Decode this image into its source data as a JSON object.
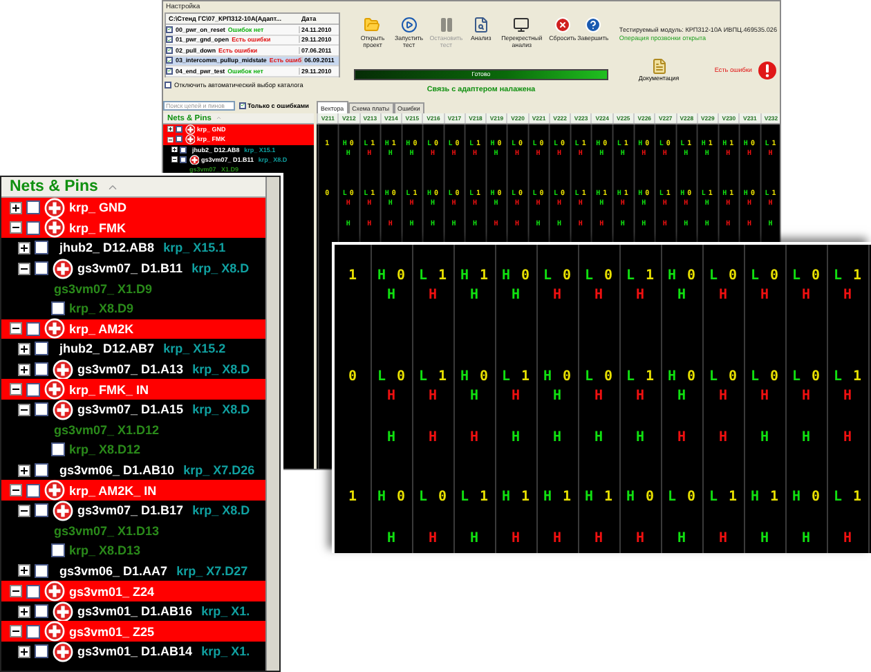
{
  "window": {
    "title": "Настройка"
  },
  "files": {
    "header": "C:\\Стенд ГС\\07_КРП312-10А(Адапт...",
    "date_header": "Дата",
    "items": [
      {
        "name": "00_pwr_on_reset",
        "status": "Ошибок нет",
        "ok": true,
        "date": "24.11.2010",
        "checked": true,
        "selected": false
      },
      {
        "name": "01_pwr_gnd_open",
        "status": "Есть ошибки",
        "ok": false,
        "date": "29.11.2010",
        "checked": true,
        "selected": false
      },
      {
        "name": "02_pull_down",
        "status": "Есть ошибки",
        "ok": false,
        "date": "07.06.2011",
        "checked": true,
        "selected": false
      },
      {
        "name": "03_intercomm_pullup_midstate",
        "status": "Есть ошиб",
        "ok": false,
        "date": "06.09.2011",
        "checked": true,
        "selected": true
      },
      {
        "name": "04_end_pwr_test",
        "status": "Ошибок нет",
        "ok": true,
        "date": "29.11.2010",
        "checked": true,
        "selected": false
      }
    ]
  },
  "auto_select": {
    "label": "Отключить автоматический выбор каталога",
    "checked": false
  },
  "toolbar": [
    {
      "kind": "open",
      "label": "Открыть проект",
      "disabled": false
    },
    {
      "kind": "run",
      "label": "Запустить тест",
      "disabled": false
    },
    {
      "kind": "stop",
      "label": "Остановить тест",
      "disabled": true
    },
    {
      "kind": "analysis",
      "label": "Анализ",
      "disabled": false
    },
    {
      "kind": "cross",
      "label": "Перекрестный анализ",
      "disabled": false
    },
    {
      "kind": "reset",
      "label": "Сбросить",
      "disabled": false
    },
    {
      "kind": "finish",
      "label": "Завершить",
      "disabled": false
    }
  ],
  "progress": {
    "label": "Готово",
    "level": 1
  },
  "connection": "Связь с адаптером налажена",
  "module": {
    "label": "Тестируемый модуль: КРП312-10А ИВПЦ.469535.026",
    "status": "Операция прозвонки открыта"
  },
  "documentation": "Документация",
  "error_status": "Есть ошибки",
  "search": {
    "placeholder": "Поиск цепей и пинов"
  },
  "only_errors": {
    "label": "Только с ошибками",
    "checked": true
  },
  "tree": {
    "header": "Nets & Pins",
    "nets": [
      {
        "kind": "net",
        "name": "krp_ GND",
        "error": true,
        "expanded": false,
        "checked": false
      },
      {
        "kind": "net",
        "name": "krp_ FMK",
        "error": true,
        "expanded": true,
        "checked": false,
        "children": [
          {
            "kind": "pin",
            "name": "jhub2_ D12.AB8",
            "ref": "krp_ X15.1",
            "error": false,
            "expanded": false,
            "checked": false
          },
          {
            "kind": "pin",
            "name": "gs3vm07_ D1.B11",
            "ref": "krp_ X8.D",
            "error": true,
            "expanded": true,
            "checked": false,
            "children": [
              {
                "kind": "connector",
                "name": "gs3vm07_ X1.D9"
              }
            ]
          }
        ]
      }
    ]
  },
  "tabs": [
    {
      "label": "Вектора",
      "selected": true
    },
    {
      "label": "Схема платы",
      "selected": false
    },
    {
      "label": "Ошибки",
      "selected": false
    }
  ],
  "vectors": {
    "columns": [
      "V211",
      "V212",
      "V213",
      "V214",
      "V215",
      "V216",
      "V217",
      "V218",
      "V219",
      "V220",
      "V221",
      "V222",
      "V223",
      "V224",
      "V225",
      "V226",
      "V227",
      "V228",
      "V229",
      "V230",
      "V231",
      "V232"
    ],
    "rows": [
      {
        "kind": "vector",
        "cells": [
          {
            "text": "1"
          },
          {
            "state": "H",
            "bit": "0"
          },
          {
            "state": "L",
            "bit": "1"
          },
          {
            "state": "H",
            "bit": "1"
          },
          {
            "state": "H",
            "bit": "0"
          },
          {
            "state": "L",
            "bit": "0"
          },
          {
            "state": "L",
            "bit": "0"
          },
          {
            "state": "L",
            "bit": "1"
          },
          {
            "state": "H",
            "bit": "0"
          },
          {
            "state": "L",
            "bit": "0"
          },
          {
            "state": "L",
            "bit": "0"
          },
          {
            "state": "L",
            "bit": "0"
          },
          {
            "state": "L",
            "bit": "1"
          },
          {
            "state": "H",
            "bit": "0"
          },
          {
            "state": "L",
            "bit": "1"
          },
          {
            "state": "H",
            "bit": "0"
          },
          {
            "state": "L",
            "bit": "0"
          },
          {
            "state": "L",
            "bit": "1"
          },
          {
            "state": "H",
            "bit": "1"
          },
          {
            "state": "H",
            "bit": "1"
          },
          {
            "state": "H",
            "bit": "0"
          },
          {
            "state": "L",
            "bit": "1"
          }
        ]
      },
      {
        "kind": "result",
        "cells": [
          {
            "kind": "blank"
          },
          {
            "text": "H",
            "pass": true
          },
          {
            "text": "H",
            "pass": false
          },
          {
            "text": "H",
            "pass": true
          },
          {
            "text": "H",
            "pass": true
          },
          {
            "text": "H",
            "pass": false
          },
          {
            "text": "H",
            "pass": false
          },
          {
            "text": "H",
            "pass": false
          },
          {
            "text": "H",
            "pass": true
          },
          {
            "text": "H",
            "pass": false
          },
          {
            "text": "H",
            "pass": false
          },
          {
            "text": "H",
            "pass": false
          },
          {
            "text": "H",
            "pass": false
          },
          {
            "text": "H",
            "pass": true
          },
          {
            "text": "H",
            "pass": true
          },
          {
            "text": "H",
            "pass": false
          },
          {
            "text": "H",
            "pass": false
          },
          {
            "text": "H",
            "pass": true
          },
          {
            "text": "H",
            "pass": true
          },
          {
            "text": "H",
            "pass": false
          },
          {
            "text": "H",
            "pass": false
          },
          {
            "text": "H",
            "pass": false
          }
        ]
      },
      {
        "kind": "blank"
      },
      {
        "kind": "blank"
      },
      {
        "kind": "blank"
      },
      {
        "kind": "vector",
        "cells": [
          {
            "text": "0"
          },
          {
            "state": "L",
            "bit": "0"
          },
          {
            "state": "L",
            "bit": "1"
          },
          {
            "state": "H",
            "bit": "0"
          },
          {
            "state": "L",
            "bit": "1"
          },
          {
            "state": "H",
            "bit": "0"
          },
          {
            "state": "L",
            "bit": "0"
          },
          {
            "state": "L",
            "bit": "1"
          },
          {
            "state": "H",
            "bit": "0"
          },
          {
            "state": "L",
            "bit": "0"
          },
          {
            "state": "L",
            "bit": "0"
          },
          {
            "state": "L",
            "bit": "0"
          },
          {
            "state": "L",
            "bit": "1"
          },
          {
            "state": "H",
            "bit": "1"
          },
          {
            "state": "H",
            "bit": "1"
          },
          {
            "state": "H",
            "bit": "0"
          },
          {
            "state": "L",
            "bit": "1"
          },
          {
            "state": "H",
            "bit": "0"
          },
          {
            "state": "L",
            "bit": "1"
          },
          {
            "state": "H",
            "bit": "1"
          },
          {
            "state": "H",
            "bit": "0"
          },
          {
            "state": "L",
            "bit": "1"
          }
        ]
      },
      {
        "kind": "result",
        "cells": [
          {
            "kind": "blank"
          },
          {
            "text": "H",
            "pass": false
          },
          {
            "text": "H",
            "pass": false
          },
          {
            "text": "H",
            "pass": true
          },
          {
            "text": "H",
            "pass": false
          },
          {
            "text": "H",
            "pass": true
          },
          {
            "text": "H",
            "pass": false
          },
          {
            "text": "H",
            "pass": false
          },
          {
            "text": "H",
            "pass": true
          },
          {
            "text": "H",
            "pass": false
          },
          {
            "text": "H",
            "pass": false
          },
          {
            "text": "H",
            "pass": false
          },
          {
            "text": "H",
            "pass": false
          },
          {
            "text": "H",
            "pass": true
          },
          {
            "text": "H",
            "pass": false
          },
          {
            "text": "H",
            "pass": true
          },
          {
            "text": "H",
            "pass": false
          },
          {
            "text": "H",
            "pass": false
          },
          {
            "text": "H",
            "pass": true
          },
          {
            "text": "H",
            "pass": false
          },
          {
            "text": "H",
            "pass": false
          },
          {
            "text": "H",
            "pass": false
          }
        ]
      },
      {
        "kind": "blank"
      },
      {
        "kind": "result",
        "cells": [
          {
            "kind": "blank"
          },
          {
            "text": "H",
            "pass": true
          },
          {
            "text": "H",
            "pass": false
          },
          {
            "text": "H",
            "pass": false
          },
          {
            "text": "H",
            "pass": true
          },
          {
            "text": "H",
            "pass": true
          },
          {
            "text": "H",
            "pass": true
          },
          {
            "text": "H",
            "pass": true
          },
          {
            "text": "H",
            "pass": false
          },
          {
            "text": "H",
            "pass": false
          },
          {
            "text": "H",
            "pass": true
          },
          {
            "text": "H",
            "pass": true
          },
          {
            "text": "H",
            "pass": false
          },
          {
            "text": "H",
            "pass": false
          },
          {
            "text": "H",
            "pass": true
          },
          {
            "text": "H",
            "pass": true
          },
          {
            "text": "H",
            "pass": false
          },
          {
            "text": "H",
            "pass": true
          },
          {
            "text": "H",
            "pass": true
          },
          {
            "text": "H",
            "pass": false
          },
          {
            "text": "H",
            "pass": false
          },
          {
            "text": "H",
            "pass": true
          }
        ]
      }
    ]
  },
  "zoom_tree": {
    "header": "Nets & Pins",
    "nets": [
      {
        "kind": "net",
        "name": "krp_ GND",
        "error": true,
        "expanded": false,
        "checked": false
      },
      {
        "kind": "net",
        "name": "krp_ FMK",
        "error": true,
        "expanded": true,
        "checked": false,
        "children": [
          {
            "kind": "pin",
            "name": "jhub2_ D12.AB8",
            "ref": "krp_ X15.1",
            "error": false,
            "expanded": false,
            "checked": false
          },
          {
            "kind": "pin",
            "name": "gs3vm07_ D1.B11",
            "ref": "krp_ X8.D",
            "error": true,
            "expanded": true,
            "checked": false,
            "children": [
              {
                "kind": "connector",
                "name": "gs3vm07_ X1.D9",
                "children": [
                  {
                    "kind": "contact",
                    "name": "krp_ X8.D9",
                    "checked": false
                  }
                ]
              }
            ]
          }
        ]
      },
      {
        "kind": "net",
        "name": "krp_ AM2K",
        "error": true,
        "expanded": true,
        "checked": false,
        "children": [
          {
            "kind": "pin",
            "name": "jhub2_ D12.AB7",
            "ref": "krp_ X15.2",
            "error": false,
            "expanded": false,
            "checked": false
          },
          {
            "kind": "pin",
            "name": "gs3vm07_ D1.A13",
            "ref": "krp_ X8.D",
            "error": true,
            "expanded": false,
            "checked": false
          }
        ]
      },
      {
        "kind": "net",
        "name": "krp_ FMK_ IN",
        "error": true,
        "expanded": true,
        "checked": false,
        "children": [
          {
            "kind": "pin",
            "name": "gs3vm07_ D1.A15",
            "ref": "krp_ X8.D",
            "error": true,
            "expanded": true,
            "checked": false,
            "children": [
              {
                "kind": "connector",
                "name": "gs3vm07_ X1.D12",
                "children": [
                  {
                    "kind": "contact",
                    "name": "krp_ X8.D12",
                    "checked": false
                  }
                ]
              }
            ]
          },
          {
            "kind": "pin",
            "name": "gs3vm06_ D1.AB10",
            "ref": "krp_ X7.D26",
            "error": false,
            "expanded": false,
            "checked": false
          }
        ]
      },
      {
        "kind": "net",
        "name": "krp_ AM2K_ IN",
        "error": true,
        "expanded": true,
        "checked": false,
        "children": [
          {
            "kind": "pin",
            "name": "gs3vm07_ D1.B17",
            "ref": "krp_ X8.D",
            "error": true,
            "expanded": true,
            "checked": false,
            "children": [
              {
                "kind": "connector",
                "name": "gs3vm07_ X1.D13",
                "children": [
                  {
                    "kind": "contact",
                    "name": "krp_ X8.D13",
                    "checked": false
                  }
                ]
              }
            ]
          },
          {
            "kind": "pin",
            "name": "gs3vm06_ D1.AA7",
            "ref": "krp_ X7.D27",
            "error": false,
            "expanded": false,
            "checked": false
          }
        ]
      },
      {
        "kind": "net",
        "name": "gs3vm01_ Z24",
        "error": true,
        "expanded": true,
        "checked": false,
        "children": [
          {
            "kind": "pin",
            "name": "gs3vm01_ D1.AB16",
            "ref": "krp_ X1.",
            "error": true,
            "expanded": false,
            "checked": false
          }
        ]
      },
      {
        "kind": "net",
        "name": "gs3vm01_ Z25",
        "error": true,
        "expanded": true,
        "checked": false,
        "children": [
          {
            "kind": "pin",
            "name": "gs3vm01_ D1.AB14",
            "ref": "krp_ X1.",
            "error": true,
            "expanded": false,
            "checked": false
          }
        ]
      }
    ]
  },
  "zoom_vectors": {
    "rows": [
      {
        "kind": "vector",
        "cells": [
          {
            "text": "1"
          },
          {
            "state": "H",
            "bit": "0"
          },
          {
            "state": "L",
            "bit": "1"
          },
          {
            "state": "H",
            "bit": "1"
          },
          {
            "state": "H",
            "bit": "0"
          },
          {
            "state": "L",
            "bit": "0"
          },
          {
            "state": "L",
            "bit": "0"
          },
          {
            "state": "L",
            "bit": "1"
          },
          {
            "state": "H",
            "bit": "0"
          },
          {
            "state": "L",
            "bit": "0"
          },
          {
            "state": "L",
            "bit": "0"
          },
          {
            "state": "L",
            "bit": "0"
          },
          {
            "state": "L",
            "bit": "1"
          }
        ]
      },
      {
        "kind": "result",
        "cells": [
          {
            "kind": "blank"
          },
          {
            "text": "H",
            "pass": true
          },
          {
            "text": "H",
            "pass": false
          },
          {
            "text": "H",
            "pass": true
          },
          {
            "text": "H",
            "pass": true
          },
          {
            "text": "H",
            "pass": false
          },
          {
            "text": "H",
            "pass": false
          },
          {
            "text": "H",
            "pass": false
          },
          {
            "text": "H",
            "pass": true
          },
          {
            "text": "H",
            "pass": false
          },
          {
            "text": "H",
            "pass": false
          },
          {
            "text": "H",
            "pass": false
          },
          {
            "text": "H",
            "pass": false
          }
        ]
      },
      {
        "kind": "blank"
      },
      {
        "kind": "blank"
      },
      {
        "kind": "blank"
      },
      {
        "kind": "vector",
        "cells": [
          {
            "text": "0"
          },
          {
            "state": "L",
            "bit": "0"
          },
          {
            "state": "L",
            "bit": "1"
          },
          {
            "state": "H",
            "bit": "0"
          },
          {
            "state": "L",
            "bit": "1"
          },
          {
            "state": "H",
            "bit": "0"
          },
          {
            "state": "L",
            "bit": "0"
          },
          {
            "state": "L",
            "bit": "1"
          },
          {
            "state": "H",
            "bit": "0"
          },
          {
            "state": "L",
            "bit": "0"
          },
          {
            "state": "L",
            "bit": "0"
          },
          {
            "state": "L",
            "bit": "0"
          },
          {
            "state": "L",
            "bit": "1"
          }
        ]
      },
      {
        "kind": "result",
        "cells": [
          {
            "kind": "blank"
          },
          {
            "text": "H",
            "pass": false
          },
          {
            "text": "H",
            "pass": false
          },
          {
            "text": "H",
            "pass": true
          },
          {
            "text": "H",
            "pass": false
          },
          {
            "text": "H",
            "pass": true
          },
          {
            "text": "H",
            "pass": false
          },
          {
            "text": "H",
            "pass": false
          },
          {
            "text": "H",
            "pass": true
          },
          {
            "text": "H",
            "pass": false
          },
          {
            "text": "H",
            "pass": false
          },
          {
            "text": "H",
            "pass": false
          },
          {
            "text": "H",
            "pass": false
          }
        ]
      },
      {
        "kind": "blank"
      },
      {
        "kind": "result",
        "cells": [
          {
            "kind": "blank"
          },
          {
            "text": "H",
            "pass": true
          },
          {
            "text": "H",
            "pass": false
          },
          {
            "text": "H",
            "pass": false
          },
          {
            "text": "H",
            "pass": true
          },
          {
            "text": "H",
            "pass": true
          },
          {
            "text": "H",
            "pass": true
          },
          {
            "text": "H",
            "pass": true
          },
          {
            "text": "H",
            "pass": false
          },
          {
            "text": "H",
            "pass": false
          },
          {
            "text": "H",
            "pass": true
          },
          {
            "text": "H",
            "pass": true
          },
          {
            "text": "H",
            "pass": false
          }
        ]
      },
      {
        "kind": "blank"
      },
      {
        "kind": "blank"
      },
      {
        "kind": "vector",
        "cells": [
          {
            "text": "1"
          },
          {
            "state": "H",
            "bit": "0"
          },
          {
            "state": "L",
            "bit": "0"
          },
          {
            "state": "L",
            "bit": "1"
          },
          {
            "state": "H",
            "bit": "1"
          },
          {
            "state": "H",
            "bit": "1"
          },
          {
            "state": "H",
            "bit": "1"
          },
          {
            "state": "H",
            "bit": "0"
          },
          {
            "state": "L",
            "bit": "0"
          },
          {
            "state": "L",
            "bit": "1"
          },
          {
            "state": "H",
            "bit": "1"
          },
          {
            "state": "H",
            "bit": "0"
          },
          {
            "state": "L",
            "bit": "1"
          }
        ]
      },
      {
        "kind": "blank"
      },
      {
        "kind": "result",
        "cells": [
          {
            "kind": "blank"
          },
          {
            "text": "H",
            "pass": true
          },
          {
            "text": "H",
            "pass": false
          },
          {
            "text": "H",
            "pass": true
          },
          {
            "text": "H",
            "pass": false
          },
          {
            "text": "H",
            "pass": false
          },
          {
            "text": "H",
            "pass": false
          },
          {
            "text": "H",
            "pass": false
          },
          {
            "text": "H",
            "pass": true
          },
          {
            "text": "H",
            "pass": false
          },
          {
            "text": "H",
            "pass": true
          },
          {
            "text": "H",
            "pass": true
          },
          {
            "text": "H",
            "pass": false
          }
        ]
      }
    ]
  }
}
